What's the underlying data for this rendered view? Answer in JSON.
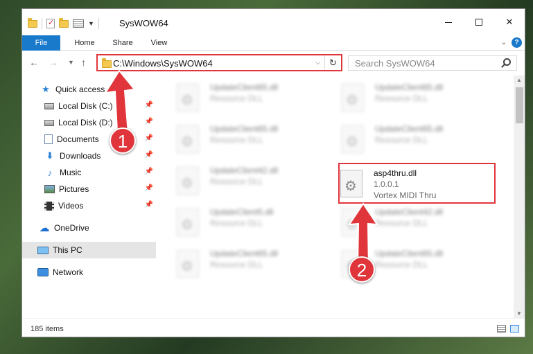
{
  "window": {
    "title": "SysWOW64"
  },
  "ribbon": {
    "tabs": [
      "File",
      "Home",
      "Share",
      "View"
    ]
  },
  "address": {
    "path": "C:\\Windows\\SysWOW64"
  },
  "search": {
    "placeholder": "Search SysWOW64"
  },
  "sidebar": {
    "items": [
      {
        "label": "Quick access",
        "icon": "star-icon"
      },
      {
        "label": "Local Disk (C:)",
        "icon": "disk-icon",
        "pinned": true
      },
      {
        "label": "Local Disk (D:)",
        "icon": "disk-icon",
        "pinned": true
      },
      {
        "label": "Documents",
        "icon": "documents-icon",
        "pinned": true
      },
      {
        "label": "Downloads",
        "icon": "downloads-icon",
        "pinned": true
      },
      {
        "label": "Music",
        "icon": "music-icon",
        "pinned": true
      },
      {
        "label": "Pictures",
        "icon": "pictures-icon",
        "pinned": true
      },
      {
        "label": "Videos",
        "icon": "videos-icon",
        "pinned": true
      },
      {
        "label": "OneDrive",
        "icon": "cloud-icon"
      },
      {
        "label": "This PC",
        "icon": "pc-icon",
        "selected": true
      },
      {
        "label": "Network",
        "icon": "network-icon"
      }
    ]
  },
  "files": {
    "left": [
      {
        "name": "UpdateClient65.dll",
        "desc": "Resource DLL"
      },
      {
        "name": "UpdateClient65.dll",
        "desc": "Resource DLL"
      },
      {
        "name": "UpdateClient42.dll",
        "desc": "Resource DLL"
      },
      {
        "name": "UpdateClient5.dll",
        "desc": "Resource DLL"
      },
      {
        "name": "UpdateClient65.dll",
        "desc": "Resource DLL"
      }
    ],
    "right": [
      {
        "name": "UpdateClient65.dll",
        "desc": "Resource DLL"
      },
      {
        "name": "UpdateClient65.dll",
        "desc": "Resource DLL"
      },
      {
        "name": "asp4thru.dll",
        "desc": "1.0.0.1",
        "desc2": "Vortex MIDI Thru"
      },
      {
        "name": "UpdateClient42.dll",
        "desc": "Resource DLL"
      },
      {
        "name": "UpdateClient65.dll",
        "desc": "Resource DLL"
      }
    ]
  },
  "status": {
    "count": "185 items"
  },
  "callouts": [
    "1",
    "2"
  ],
  "colors": {
    "accent": "#1979ca",
    "highlight": "#e0353b"
  }
}
